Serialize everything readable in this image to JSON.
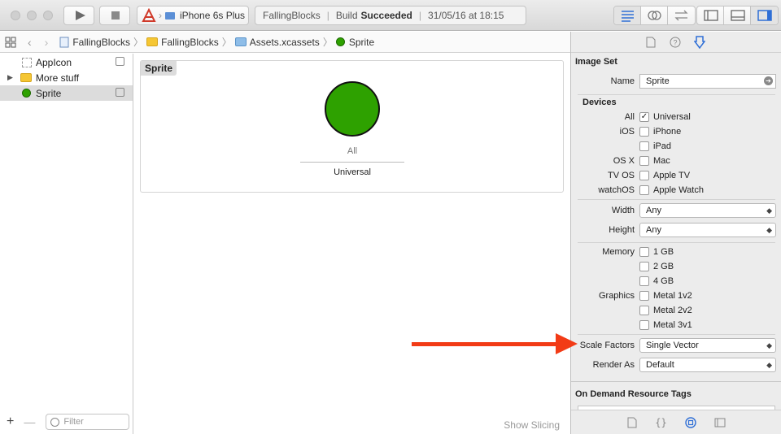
{
  "toolbar": {
    "scheme_target": "iPhone 6s Plus",
    "activity_project": "FallingBlocks",
    "activity_build": "Build",
    "activity_status": "Succeeded",
    "activity_time": "31/05/16 at 18:15"
  },
  "jumpbar": {
    "crumbs": [
      "FallingBlocks",
      "FallingBlocks",
      "Assets.xcassets",
      "Sprite"
    ]
  },
  "navigator": {
    "items": [
      {
        "label": "AppIcon"
      },
      {
        "label": "More stuff"
      },
      {
        "label": "Sprite"
      }
    ],
    "filter_placeholder": "Filter"
  },
  "canvas": {
    "set_title": "Sprite",
    "slot_label": "All",
    "slot_caption": "Universal",
    "show_slicing": "Show Slicing",
    "sprite_color": "#2ea100"
  },
  "inspector": {
    "section_image_set": "Image Set",
    "name_label": "Name",
    "name_value": "Sprite",
    "section_devices": "Devices",
    "devices": [
      {
        "label": "All",
        "option": "Universal",
        "checked": true
      },
      {
        "label": "iOS",
        "option": "iPhone",
        "checked": false
      },
      {
        "label": "",
        "option": "iPad",
        "checked": false
      },
      {
        "label": "OS X",
        "option": "Mac",
        "checked": false
      },
      {
        "label": "TV OS",
        "option": "Apple TV",
        "checked": false
      },
      {
        "label": "watchOS",
        "option": "Apple Watch",
        "checked": false
      }
    ],
    "width_label": "Width",
    "width_value": "Any",
    "height_label": "Height",
    "height_value": "Any",
    "memory_label": "Memory",
    "memory_options": [
      "1 GB",
      "2 GB",
      "4 GB"
    ],
    "graphics_label": "Graphics",
    "graphics_options": [
      "Metal 1v2",
      "Metal 2v2",
      "Metal 3v1"
    ],
    "scale_label": "Scale Factors",
    "scale_value": "Single Vector",
    "render_label": "Render As",
    "render_value": "Default",
    "section_odr": "On Demand Resource Tags"
  },
  "annotation": {
    "arrow_color": "#f23b16"
  }
}
